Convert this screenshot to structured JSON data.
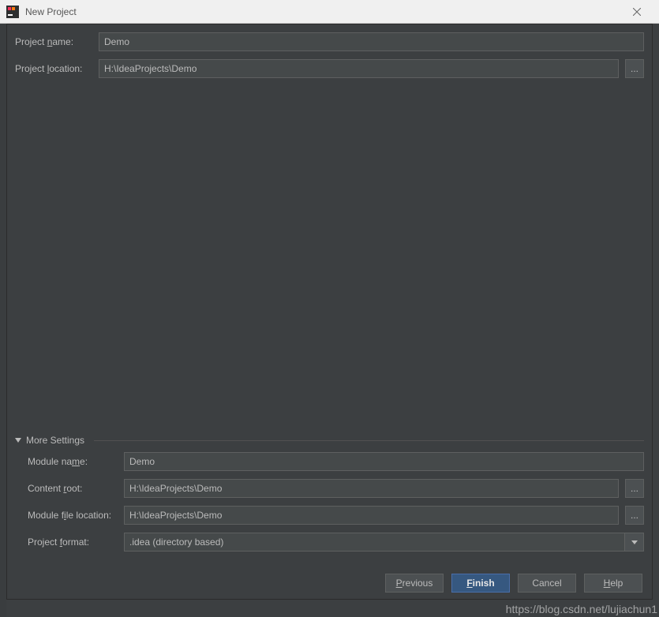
{
  "window": {
    "title": "New Project"
  },
  "fields": {
    "project_name": {
      "label_html": "Project <u>n</u>ame:",
      "value": "Demo"
    },
    "project_location": {
      "label_html": "Project <u>l</u>ocation:",
      "value": "H:\\IdeaProjects\\Demo"
    }
  },
  "more": {
    "section_label": "More Settings",
    "module_name": {
      "label_html": "Module na<u>m</u>e:",
      "value": "Demo"
    },
    "content_root": {
      "label_html": "Content <u>r</u>oot:",
      "value": "H:\\IdeaProjects\\Demo"
    },
    "module_file": {
      "label_html": "Module f<u>i</u>le location:",
      "value": "H:\\IdeaProjects\\Demo"
    },
    "project_format": {
      "label_html": "Project <u>f</u>ormat:",
      "value": ".idea (directory based)"
    }
  },
  "buttons": {
    "previous": "Previous",
    "finish": "Finish",
    "cancel": "Cancel",
    "help": "Help"
  },
  "browse_glyph": "...",
  "watermark": "https://blog.csdn.net/lujiachun1"
}
